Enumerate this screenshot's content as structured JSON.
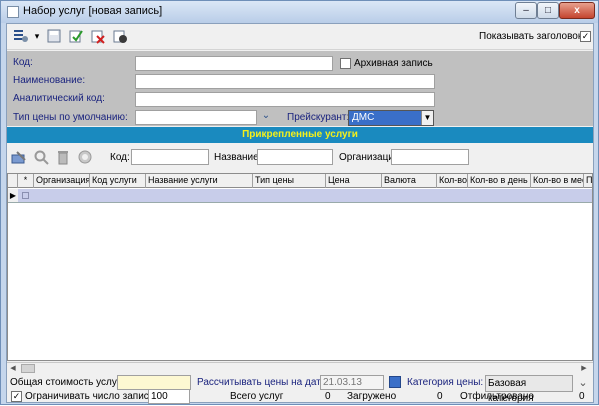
{
  "window": {
    "title": "Набор услуг [новая запись]",
    "minimize_label": "–",
    "maximize_label": "□",
    "close_label": "x"
  },
  "toolbar": {
    "show_header_label": "Показывать заголовок",
    "show_header_checked": "✓",
    "dropdown_arrow": "▾"
  },
  "form": {
    "code_label": "Код:",
    "code_value": "",
    "archive_label": "Архивная запись",
    "name_label": "Наименование:",
    "name_value": "",
    "analytic_code_label": "Аналитический код:",
    "analytic_code_value": "",
    "price_type_label": "Тип цены по умолчанию:",
    "price_type_value": "",
    "price_list_label": "Прейскурант:",
    "price_list_value": "ДМС",
    "combo_arrow": "▼"
  },
  "services_section": {
    "title": "Прикрепленные услуги"
  },
  "filter": {
    "code_label": "Код:",
    "name_label": "Название:",
    "org_label": "Организация:"
  },
  "grid": {
    "columns": [
      "*",
      "Организация",
      "Код услуги",
      "Название услуги",
      "Тип цены",
      "Цена",
      "Валюта",
      "Кол-во",
      "Кол-во в день",
      "Кол-во в мес",
      "П"
    ],
    "row_marker": "▶"
  },
  "footer": {
    "total_cost_label": "Общая стоимость услуг :",
    "total_cost_value": "",
    "calc_date_label": "Рассчитывать цены на дату:",
    "calc_date_value": "21.03.13",
    "price_category_label": "Категория цены:",
    "price_category_value": "Базовая категория",
    "limit_label": "Ограничивать число записей:",
    "limit_checked": "✓",
    "limit_value": "100",
    "total_services_label": "Всего услуг",
    "total_services_value": "0",
    "loaded_label": "Загружено",
    "loaded_value": "0",
    "filtered_label": "Отфильтровано",
    "filtered_value": "0"
  },
  "colors": {
    "section_header_bg": "#1a8abf",
    "section_header_text": "#f5f01a",
    "label_blue": "#1a237e",
    "selected_combo": "#3a6fc8"
  }
}
